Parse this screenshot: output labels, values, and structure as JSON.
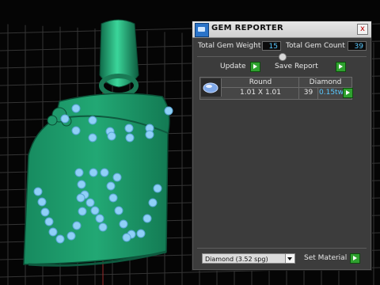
{
  "window": {
    "title": "GEM REPORTER",
    "close_symbol": "x"
  },
  "stats": {
    "weight_label": "Total Gem Weight",
    "weight_value": "15",
    "count_label": "Total Gem Count",
    "count_value": "39"
  },
  "actions": {
    "update_label": "Update",
    "save_label": "Save Report"
  },
  "gem_table": {
    "shape_header": "Round",
    "material_header": "Diamond",
    "size": "1.01 X 1.01",
    "count": "39",
    "weight": "0.15tw"
  },
  "material": {
    "selected": "Diamond   (3.52 spg)",
    "set_label": "Set Material"
  },
  "colors": {
    "pendant": "#1f9a6c",
    "gem": "#8fd0f6",
    "grid": "#3a3a3a",
    "panel": "#3c3c3c",
    "value_text": "#58c8ff"
  }
}
